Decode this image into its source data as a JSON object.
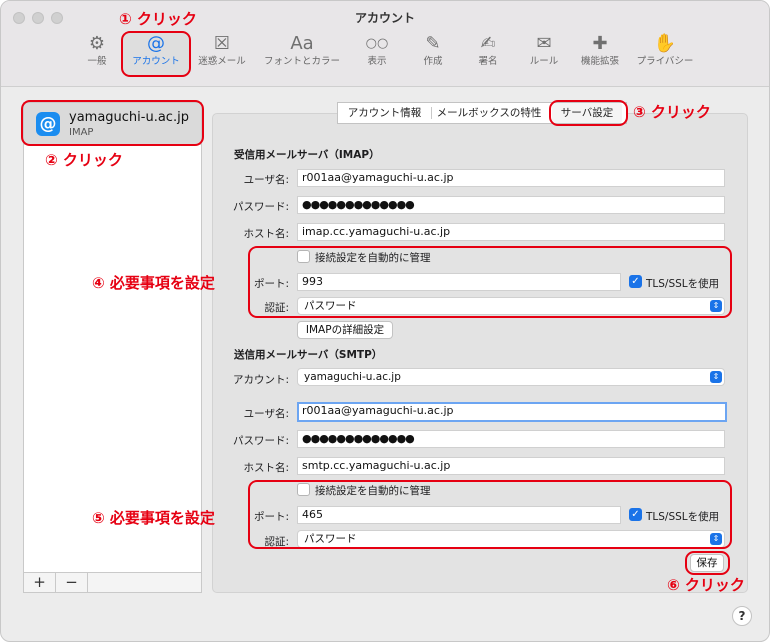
{
  "window": {
    "title": "アカウント"
  },
  "toolbar": {
    "items": [
      {
        "label": "一般",
        "icon": "gear-icon",
        "glyph": "⚙"
      },
      {
        "label": "アカウント",
        "icon": "at-icon",
        "glyph": "@"
      },
      {
        "label": "迷惑メール",
        "icon": "junk-mail-icon",
        "glyph": "☒"
      },
      {
        "label": "フォントとカラー",
        "icon": "font-icon",
        "glyph": "Aa"
      },
      {
        "label": "表示",
        "icon": "glasses-icon",
        "glyph": "○○"
      },
      {
        "label": "作成",
        "icon": "compose-icon",
        "glyph": "✎"
      },
      {
        "label": "署名",
        "icon": "signature-icon",
        "glyph": "✍"
      },
      {
        "label": "ルール",
        "icon": "rules-icon",
        "glyph": "✉"
      },
      {
        "label": "機能拡張",
        "icon": "extensions-icon",
        "glyph": "✚"
      },
      {
        "label": "プライバシー",
        "icon": "privacy-hand-icon",
        "glyph": "✋"
      }
    ]
  },
  "accounts": {
    "items": [
      {
        "name": "yamaguchi-u.ac.jp",
        "type": "IMAP",
        "icon_glyph": "@"
      }
    ],
    "add_label": "+",
    "remove_label": "−"
  },
  "tabs": [
    {
      "label": "アカウント情報"
    },
    {
      "label": "メールボックスの特性"
    },
    {
      "label": "サーバ設定"
    }
  ],
  "incoming": {
    "title": "受信用メールサーバ（IMAP）",
    "username_label": "ユーザ名:",
    "username": "r001aa@yamaguchi-u.ac.jp",
    "password_label": "パスワード:",
    "password": "●●●●●●●●●●●●●",
    "host_label": "ホスト名:",
    "host": "imap.cc.yamaguchi-u.ac.jp",
    "auto_manage_label": "接続設定を自動的に管理",
    "port_label": "ポート:",
    "port": "993",
    "tls_label": "TLS/SSLを使用",
    "auth_label": "認証:",
    "auth": "パスワード",
    "advanced_button": "IMAPの詳細設定"
  },
  "outgoing": {
    "title": "送信用メールサーバ（SMTP）",
    "account_label": "アカウント:",
    "account": "yamaguchi-u.ac.jp",
    "username_label": "ユーザ名:",
    "username": "r001aa@yamaguchi-u.ac.jp",
    "password_label": "パスワード:",
    "password": "●●●●●●●●●●●●●",
    "host_label": "ホスト名:",
    "host": "smtp.cc.yamaguchi-u.ac.jp",
    "auto_manage_label": "接続設定を自動的に管理",
    "port_label": "ポート:",
    "port": "465",
    "tls_label": "TLS/SSLを使用",
    "auth_label": "認証:",
    "auth": "パスワード"
  },
  "save_button": "保存",
  "help_label": "?",
  "annotations": {
    "step1": "① クリック",
    "step2": "② クリック",
    "step3": "③ クリック",
    "step4": "④ 必要事項を設定",
    "step5": "⑤ 必要事項を設定",
    "step6": "⑥ クリック"
  },
  "colors": {
    "accent": "#1a73e8",
    "annotation": "#e60012",
    "account_icon": "#1b8df0"
  }
}
